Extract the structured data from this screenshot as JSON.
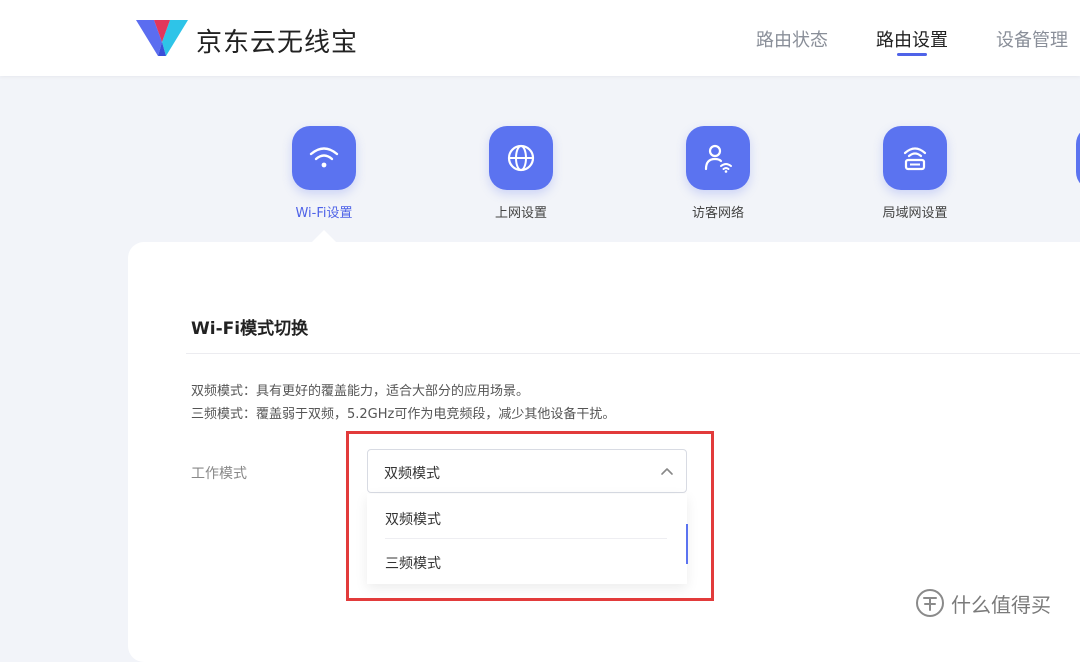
{
  "header": {
    "brand": "京东云无线宝",
    "nav": [
      {
        "label": "路由状态",
        "active": false
      },
      {
        "label": "路由设置",
        "active": true
      },
      {
        "label": "设备管理",
        "active": false
      }
    ]
  },
  "functions": [
    {
      "label": "Wi-Fi设置",
      "icon": "wifi-icon",
      "active": true
    },
    {
      "label": "上网设置",
      "icon": "globe-icon",
      "active": false
    },
    {
      "label": "访客网络",
      "icon": "guest-user-icon",
      "active": false
    },
    {
      "label": "局域网设置",
      "icon": "lan-router-icon",
      "active": false
    }
  ],
  "section": {
    "title": "Wi-Fi模式切换",
    "desc_dual": "双频模式：具有更好的覆盖能力，适合大部分的应用场景。",
    "desc_tri": "三频模式：覆盖弱于双频，5.2GHz可作为电竞频段，减少其他设备干扰。"
  },
  "form": {
    "label": "工作模式",
    "selected": "双频模式",
    "options": [
      "双频模式",
      "三频模式"
    ]
  },
  "watermark": {
    "text": "什么值得买",
    "icon": "smzdm-logo-icon"
  },
  "colors": {
    "accent": "#5b73f0",
    "highlight": "#e23b3b"
  }
}
